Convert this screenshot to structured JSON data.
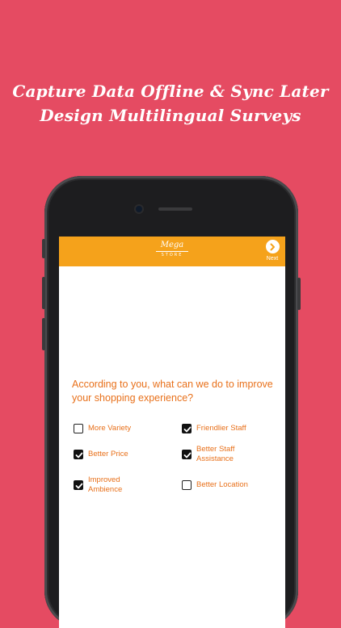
{
  "headline": {
    "line1": "Capture Data Offline & Sync Later",
    "line2": "Design Multilingual Surveys"
  },
  "app": {
    "logo_main": "Mega",
    "logo_sub": "STORE",
    "next_label": "Next",
    "header_color": "#f5a21b"
  },
  "survey": {
    "question": "According to you, what can we do to improve your shopping experience?",
    "options": [
      {
        "label": "More Variety",
        "checked": false
      },
      {
        "label": "Friendlier Staff",
        "checked": true
      },
      {
        "label": "Better Price",
        "checked": true
      },
      {
        "label": "Better Staff Assistance",
        "checked": true
      },
      {
        "label": "Improved Ambience",
        "checked": true
      },
      {
        "label": "Better Location",
        "checked": false
      }
    ]
  },
  "colors": {
    "background": "#e54b62",
    "accent_text": "#e8701a"
  }
}
